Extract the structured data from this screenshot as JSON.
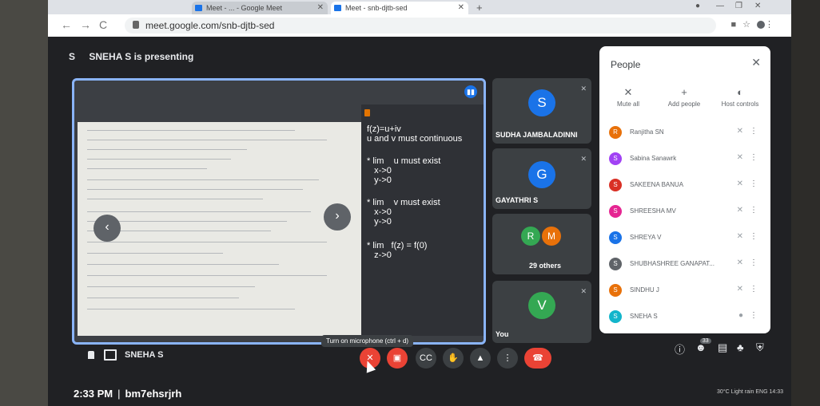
{
  "browser": {
    "tabs": [
      {
        "label": "Meet - ... - Google Meet"
      },
      {
        "label": "Meet - snb-djtb-sed"
      }
    ],
    "new_tab": "+",
    "url": "meet.google.com/snb-djtb-sed"
  },
  "meet": {
    "presenting": {
      "initial": "S",
      "text": "SNEHA S is presenting"
    },
    "slide_lines": [
      "f(z)=u+iv",
      "u and v must continuous",
      "* lim    u must exist",
      "   x->0",
      "   y->0",
      "* lim    v must exist",
      "   x->0",
      "   y->0",
      "* lim   f(z) = f(0)",
      "   z->0"
    ],
    "presenter_name": "SNEHA S",
    "tiles": [
      {
        "name": "SUDHA JAMBALADINNI",
        "initial": "S",
        "color": "#1a73e8"
      },
      {
        "name": "GAYATHRI S",
        "initial": "G",
        "color": "#1a73e8"
      },
      {
        "name": "29 others",
        "initials": [
          "R",
          "M"
        ],
        "colors": [
          "#34a853",
          "#e8710a"
        ]
      },
      {
        "name": "You",
        "initial": "V",
        "color": "#34a853"
      }
    ],
    "people_panel": {
      "title": "People",
      "controls": [
        {
          "label": "Mute all",
          "icon": "mic-off-icon"
        },
        {
          "label": "Add people",
          "icon": "add-person-icon"
        },
        {
          "label": "Host controls",
          "icon": "toggle-icon"
        }
      ],
      "participants": [
        {
          "name": "Ranjitha SN",
          "initial": "R",
          "color": "#e8710a"
        },
        {
          "name": "Sabina Sanawrk",
          "initial": "S",
          "color": "#a142f4"
        },
        {
          "name": "SAKEENA BANUA",
          "initial": "S",
          "color": "#d93025"
        },
        {
          "name": "SHREESHA MV",
          "initial": "S",
          "color": "#e52592"
        },
        {
          "name": "SHREYA V",
          "initial": "S",
          "color": "#1a73e8"
        },
        {
          "name": "SHUBHASHREE GANAPAT...",
          "initial": "S",
          "color": "#5f6368"
        },
        {
          "name": "SINDHU J",
          "initial": "S",
          "color": "#e8710a"
        },
        {
          "name": "SNEHA S",
          "initial": "S",
          "color": "#12b5cb"
        }
      ]
    },
    "tooltip": "Turn on microphone (ctrl + d)",
    "time": "2:33 PM",
    "meeting_code": "bm7ehsrjrh",
    "participant_badge": "33",
    "taskbar_text": "30°C Light rain  ENG  14:33"
  }
}
